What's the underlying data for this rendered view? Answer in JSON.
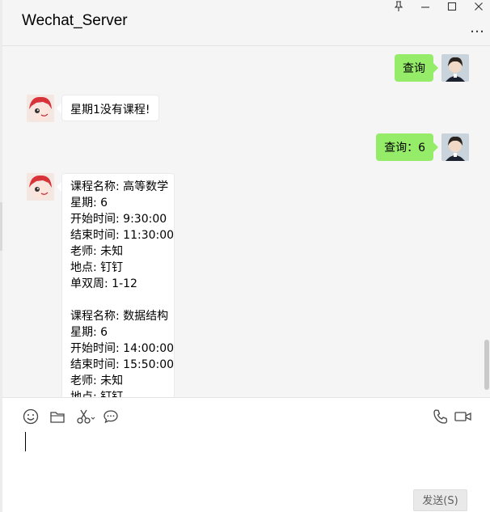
{
  "window": {
    "title": "Wechat_Server",
    "controls": {
      "pin": "⊥",
      "minimize": "—",
      "maximize": "☐",
      "close": "✕"
    },
    "more": "…"
  },
  "messages": [
    {
      "side": "right",
      "text": "查询"
    },
    {
      "side": "left",
      "text": "星期1没有课程!"
    },
    {
      "side": "right",
      "text": "查询：6"
    },
    {
      "side": "left",
      "lines": [
        "课程名称: 高等数学",
        "星期: 6",
        "开始时间: 9:30:00",
        "结束时间: 11:30:00",
        "老师: 未知",
        "地点: 钉钉",
        "单双周: 1-12",
        "",
        "课程名称: 数据结构",
        "星期: 6",
        "开始时间: 14:00:00",
        "结束时间: 15:50:00",
        "老师: 未知",
        "地点: 钉钉"
      ]
    }
  ],
  "toolbar": {
    "icons": [
      "emoji-icon",
      "folder-icon",
      "screenshot-icon",
      "chat-history-icon",
      "phone-icon",
      "video-icon"
    ]
  },
  "input": {
    "value": ""
  },
  "send_button": {
    "label": "发送(S)"
  },
  "colors": {
    "self_bubble": "#95ec69",
    "other_bubble": "#ffffff",
    "background": "#f5f5f5"
  }
}
